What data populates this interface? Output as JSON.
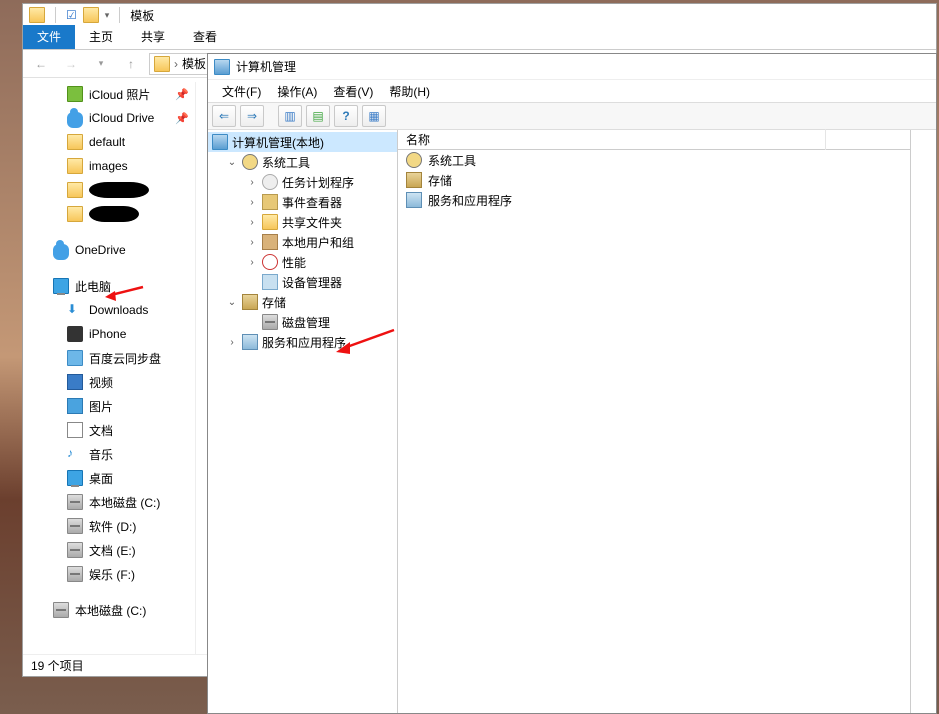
{
  "explorer": {
    "title": "模板",
    "ribbon": {
      "file": "文件",
      "home": "主页",
      "share": "共享",
      "view": "查看"
    },
    "breadcrumb_root": "模板",
    "nav": {
      "quick": [
        {
          "label": "iCloud 照片",
          "icon": "icloud-photos-icon",
          "pinned": true
        },
        {
          "label": "iCloud Drive",
          "icon": "icloud-drive-icon",
          "pinned": true
        },
        {
          "label": "default",
          "icon": "folder-icon"
        },
        {
          "label": "images",
          "icon": "folder-icon"
        },
        {
          "label": "",
          "icon": "folder-icon",
          "redacted": true
        },
        {
          "label": "",
          "icon": "folder-icon",
          "redacted": true
        }
      ],
      "onedrive": "OneDrive",
      "this_pc": "此电脑",
      "pc_items": [
        {
          "label": "Downloads",
          "icon": "downloads-icon"
        },
        {
          "label": "iPhone",
          "icon": "iphone-icon"
        },
        {
          "label": "百度云同步盘",
          "icon": "baidu-sync-icon"
        },
        {
          "label": "视频",
          "icon": "videos-icon"
        },
        {
          "label": "图片",
          "icon": "pictures-icon"
        },
        {
          "label": "文档",
          "icon": "documents-icon"
        },
        {
          "label": "音乐",
          "icon": "music-icon"
        },
        {
          "label": "桌面",
          "icon": "desktop-icon"
        },
        {
          "label": "本地磁盘 (C:)",
          "icon": "drive-icon"
        },
        {
          "label": "软件 (D:)",
          "icon": "drive-icon"
        },
        {
          "label": "文档 (E:)",
          "icon": "drive-icon"
        },
        {
          "label": "娱乐 (F:)",
          "icon": "drive-icon"
        }
      ],
      "extra_drive": "本地磁盘 (C:)"
    },
    "status": "19 个项目"
  },
  "mmc": {
    "title": "计算机管理",
    "menu": {
      "file": "文件(F)",
      "action": "操作(A)",
      "view": "查看(V)",
      "help": "帮助(H)"
    },
    "tree": {
      "root": "计算机管理(本地)",
      "system_tools": "系统工具",
      "system_tools_children": [
        "任务计划程序",
        "事件查看器",
        "共享文件夹",
        "本地用户和组",
        "性能",
        "设备管理器"
      ],
      "storage": "存储",
      "storage_children": [
        "磁盘管理"
      ],
      "services": "服务和应用程序"
    },
    "list_header": "名称",
    "list_items": [
      "系统工具",
      "存储",
      "服务和应用程序"
    ]
  }
}
